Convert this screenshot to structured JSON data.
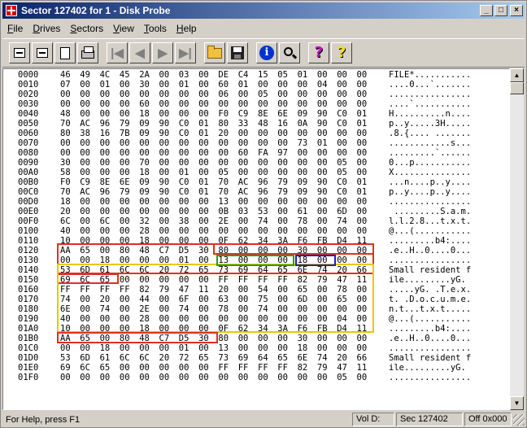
{
  "window": {
    "title": "Sector 127402 for 1 - Disk Probe",
    "minimize": "_",
    "maximize": "□",
    "close": "×"
  },
  "menu": [
    {
      "label": "File",
      "ul": "F",
      "rest": "ile"
    },
    {
      "label": "Drives",
      "ul": "D",
      "rest": "rives"
    },
    {
      "label": "Sectors",
      "ul": "S",
      "rest": "ectors"
    },
    {
      "label": "View",
      "ul": "V",
      "rest": "iew"
    },
    {
      "label": "Tools",
      "ul": "T",
      "rest": "ools"
    },
    {
      "label": "Help",
      "ul": "H",
      "rest": "elp"
    }
  ],
  "toolbar": [
    {
      "name": "drive-icon"
    },
    {
      "name": "volume-icon"
    },
    {
      "name": "page-icon"
    },
    {
      "name": "printer-icon"
    },
    {
      "name": "first-sector-icon",
      "glyph": "|◀"
    },
    {
      "name": "prev-sector-icon",
      "glyph": "◀"
    },
    {
      "name": "next-sector-icon",
      "glyph": "▶"
    },
    {
      "name": "last-sector-icon",
      "glyph": "▶|"
    },
    {
      "name": "open-folder-icon"
    },
    {
      "name": "save-disk-icon"
    },
    {
      "name": "info-icon",
      "glyph": "i"
    },
    {
      "name": "search-icon"
    },
    {
      "name": "help-icon",
      "glyph": "?"
    },
    {
      "name": "context-help-icon",
      "glyph": "?"
    }
  ],
  "hex_rows": [
    {
      "addr": "0000",
      "bytes": [
        "46",
        "49",
        "4C",
        "45",
        "2A",
        "00",
        "03",
        "00",
        "DE",
        "C4",
        "15",
        "05",
        "01",
        "00",
        "00",
        "00"
      ],
      "ascii": "FILE*..........."
    },
    {
      "addr": "0010",
      "bytes": [
        "07",
        "00",
        "01",
        "00",
        "30",
        "00",
        "01",
        "00",
        "60",
        "01",
        "00",
        "00",
        "00",
        "04",
        "00",
        "00"
      ],
      "ascii": "....0...`......."
    },
    {
      "addr": "0020",
      "bytes": [
        "00",
        "00",
        "00",
        "00",
        "00",
        "00",
        "00",
        "00",
        "06",
        "00",
        "05",
        "00",
        "00",
        "00",
        "00",
        "00"
      ],
      "ascii": "................"
    },
    {
      "addr": "0030",
      "bytes": [
        "00",
        "00",
        "00",
        "00",
        "60",
        "00",
        "00",
        "00",
        "00",
        "00",
        "00",
        "00",
        "00",
        "00",
        "00",
        "00"
      ],
      "ascii": "....`..........."
    },
    {
      "addr": "0040",
      "bytes": [
        "48",
        "00",
        "00",
        "00",
        "18",
        "00",
        "00",
        "00",
        "F0",
        "C9",
        "8E",
        "6E",
        "09",
        "90",
        "C0",
        "01"
      ],
      "ascii": "H..........n...."
    },
    {
      "addr": "0050",
      "bytes": [
        "70",
        "AC",
        "96",
        "79",
        "09",
        "90",
        "C0",
        "01",
        "80",
        "33",
        "48",
        "16",
        "0A",
        "90",
        "C0",
        "01"
      ],
      "ascii": "p..y.....3H....."
    },
    {
      "addr": "0060",
      "bytes": [
        "80",
        "38",
        "16",
        "7B",
        "09",
        "90",
        "C0",
        "01",
        "20",
        "00",
        "00",
        "00",
        "00",
        "00",
        "00",
        "00"
      ],
      "ascii": ".8.{.... ......."
    },
    {
      "addr": "0070",
      "bytes": [
        "00",
        "00",
        "00",
        "00",
        "00",
        "00",
        "00",
        "00",
        "00",
        "00",
        "00",
        "00",
        "73",
        "01",
        "00",
        "00"
      ],
      "ascii": "............s..."
    },
    {
      "addr": "0080",
      "bytes": [
        "00",
        "00",
        "00",
        "00",
        "00",
        "00",
        "00",
        "00",
        "00",
        "60",
        "FA",
        "97",
        "00",
        "00",
        "00",
        "00"
      ],
      "ascii": ".........`......"
    },
    {
      "addr": "0090",
      "bytes": [
        "30",
        "00",
        "00",
        "00",
        "70",
        "00",
        "00",
        "00",
        "00",
        "00",
        "00",
        "00",
        "00",
        "00",
        "05",
        "00"
      ],
      "ascii": "0...p..........."
    },
    {
      "addr": "00A0",
      "bytes": [
        "58",
        "00",
        "00",
        "00",
        "18",
        "00",
        "01",
        "00",
        "05",
        "00",
        "00",
        "00",
        "00",
        "00",
        "05",
        "00"
      ],
      "ascii": "X..............."
    },
    {
      "addr": "00B0",
      "bytes": [
        "F0",
        "C9",
        "8E",
        "6E",
        "09",
        "90",
        "C0",
        "01",
        "70",
        "AC",
        "96",
        "79",
        "09",
        "90",
        "C0",
        "01"
      ],
      "ascii": "...n....p..y...."
    },
    {
      "addr": "00C0",
      "bytes": [
        "70",
        "AC",
        "96",
        "79",
        "09",
        "90",
        "C0",
        "01",
        "70",
        "AC",
        "96",
        "79",
        "09",
        "90",
        "C0",
        "01"
      ],
      "ascii": "p..y....p..y...."
    },
    {
      "addr": "00D0",
      "bytes": [
        "18",
        "00",
        "00",
        "00",
        "00",
        "00",
        "00",
        "00",
        "13",
        "00",
        "00",
        "00",
        "00",
        "00",
        "00",
        "00"
      ],
      "ascii": "................"
    },
    {
      "addr": "00E0",
      "bytes": [
        "20",
        "00",
        "00",
        "00",
        "00",
        "00",
        "00",
        "00",
        "0B",
        "03",
        "53",
        "00",
        "61",
        "00",
        "6D",
        "00"
      ],
      "ascii": " .........S.a.m."
    },
    {
      "addr": "00F0",
      "bytes": [
        "6C",
        "00",
        "6C",
        "00",
        "32",
        "00",
        "38",
        "00",
        "2E",
        "00",
        "74",
        "00",
        "78",
        "00",
        "74",
        "00"
      ],
      "ascii": "l.l.2.8...t.x.t."
    },
    {
      "addr": "0100",
      "bytes": [
        "40",
        "00",
        "00",
        "00",
        "28",
        "00",
        "00",
        "00",
        "00",
        "00",
        "00",
        "00",
        "00",
        "00",
        "00",
        "00"
      ],
      "ascii": "@...(..........."
    },
    {
      "addr": "0110",
      "bytes": [
        "10",
        "00",
        "00",
        "00",
        "18",
        "00",
        "00",
        "00",
        "0F",
        "62",
        "34",
        "3A",
        "F6",
        "FB",
        "D4",
        "11"
      ],
      "ascii": ".........b4:...."
    },
    {
      "addr": "0120",
      "bytes": [
        "AA",
        "65",
        "00",
        "80",
        "48",
        "C7",
        "D5",
        "30",
        "80",
        "00",
        "00",
        "00",
        "30",
        "00",
        "00",
        "00"
      ],
      "ascii": ".e..H..0....0..."
    },
    {
      "addr": "0130",
      "bytes": [
        "00",
        "00",
        "18",
        "00",
        "00",
        "00",
        "01",
        "00",
        "13",
        "00",
        "00",
        "00",
        "18",
        "00",
        "00",
        "00"
      ],
      "ascii": "................"
    },
    {
      "addr": "0140",
      "bytes": [
        "53",
        "6D",
        "61",
        "6C",
        "6C",
        "20",
        "72",
        "65",
        "73",
        "69",
        "64",
        "65",
        "6E",
        "74",
        "20",
        "66"
      ],
      "ascii": "Small resident f"
    },
    {
      "addr": "0150",
      "bytes": [
        "69",
        "6C",
        "65",
        "00",
        "00",
        "00",
        "00",
        "00",
        "FF",
        "FF",
        "FF",
        "FF",
        "82",
        "79",
        "47",
        "11"
      ],
      "ascii": "ile.........yG."
    },
    {
      "addr": "0160",
      "bytes": [
        "FF",
        "FF",
        "FF",
        "FF",
        "82",
        "79",
        "47",
        "11",
        "20",
        "00",
        "54",
        "00",
        "65",
        "00",
        "78",
        "00"
      ],
      "ascii": ".....yG. .T.e.x."
    },
    {
      "addr": "0170",
      "bytes": [
        "74",
        "00",
        "20",
        "00",
        "44",
        "00",
        "6F",
        "00",
        "63",
        "00",
        "75",
        "00",
        "6D",
        "00",
        "65",
        "00"
      ],
      "ascii": "t. .D.o.c.u.m.e."
    },
    {
      "addr": "0180",
      "bytes": [
        "6E",
        "00",
        "74",
        "00",
        "2E",
        "00",
        "74",
        "00",
        "78",
        "00",
        "74",
        "00",
        "00",
        "00",
        "00",
        "00"
      ],
      "ascii": "n.t...t.x.t....."
    },
    {
      "addr": "0190",
      "bytes": [
        "40",
        "00",
        "00",
        "00",
        "28",
        "00",
        "00",
        "00",
        "00",
        "00",
        "00",
        "00",
        "00",
        "00",
        "04",
        "00"
      ],
      "ascii": "@...(..........."
    },
    {
      "addr": "01A0",
      "bytes": [
        "10",
        "00",
        "00",
        "00",
        "18",
        "00",
        "00",
        "00",
        "0F",
        "62",
        "34",
        "3A",
        "F6",
        "FB",
        "D4",
        "11"
      ],
      "ascii": ".........b4:...."
    },
    {
      "addr": "01B0",
      "bytes": [
        "AA",
        "65",
        "00",
        "80",
        "48",
        "C7",
        "D5",
        "30",
        "80",
        "00",
        "00",
        "00",
        "30",
        "00",
        "00",
        "00"
      ],
      "ascii": ".e..H..0....0..."
    },
    {
      "addr": "01C0",
      "bytes": [
        "00",
        "00",
        "18",
        "00",
        "00",
        "00",
        "01",
        "00",
        "13",
        "00",
        "00",
        "00",
        "18",
        "00",
        "00",
        "00"
      ],
      "ascii": "................"
    },
    {
      "addr": "01D0",
      "bytes": [
        "53",
        "6D",
        "61",
        "6C",
        "6C",
        "20",
        "72",
        "65",
        "73",
        "69",
        "64",
        "65",
        "6E",
        "74",
        "20",
        "66"
      ],
      "ascii": "Small resident f"
    },
    {
      "addr": "01E0",
      "bytes": [
        "69",
        "6C",
        "65",
        "00",
        "00",
        "00",
        "00",
        "00",
        "FF",
        "FF",
        "FF",
        "FF",
        "82",
        "79",
        "47",
        "11"
      ],
      "ascii": "ile.........yG."
    },
    {
      "addr": "01F0",
      "bytes": [
        "00",
        "00",
        "00",
        "00",
        "00",
        "00",
        "00",
        "00",
        "00",
        "00",
        "00",
        "00",
        "00",
        "00",
        "05",
        "00"
      ],
      "ascii": "................"
    }
  ],
  "highlight_colors": {
    "red": "#e03020",
    "green": "#20a020",
    "blue": "#2020c0",
    "yellow": "#e8c800"
  },
  "status": {
    "help": "For Help, press F1",
    "volume": "Vol D:",
    "sector": "Sec 127402",
    "offset": "Off 0x000"
  }
}
